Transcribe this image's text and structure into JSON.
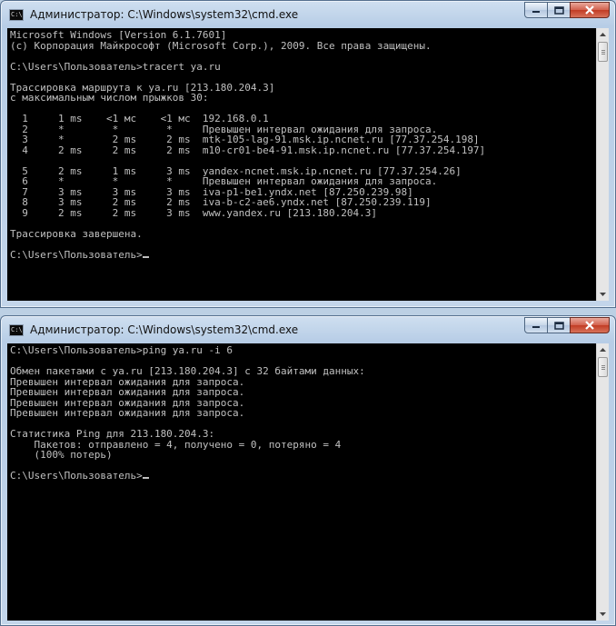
{
  "window1": {
    "title": "Администратор: C:\\Windows\\system32\\cmd.exe",
    "icon_label": "C:\\",
    "lines": [
      "Microsoft Windows [Version 6.1.7601]",
      "(c) Корпорация Майкрософт (Microsoft Corp.), 2009. Все права защищены.",
      "",
      "C:\\Users\\Пользователь>tracert ya.ru",
      "",
      "Трассировка маршрута к ya.ru [213.180.204.3]",
      "с максимальным числом прыжков 30:",
      "",
      "  1     1 ms    <1 мс    <1 мс  192.168.0.1",
      "  2     *        *        *     Превышен интервал ожидания для запроса.",
      "  3     *        2 ms     2 ms  mtk-105-lag-91.msk.ip.ncnet.ru [77.37.254.198]",
      "  4     2 ms     2 ms     2 ms  m10-cr01-be4-91.msk.ip.ncnet.ru [77.37.254.197]",
      "",
      "  5     2 ms     1 ms     3 ms  yandex-ncnet.msk.ip.ncnet.ru [77.37.254.26]",
      "  6     *        *        *     Превышен интервал ожидания для запроса.",
      "  7     3 ms     3 ms     3 ms  iva-p1-be1.yndx.net [87.250.239.98]",
      "  8     3 ms     2 ms     2 ms  iva-b-c2-ae6.yndx.net [87.250.239.119]",
      "  9     2 ms     2 ms     3 ms  www.yandex.ru [213.180.204.3]",
      "",
      "Трассировка завершена.",
      "",
      "C:\\Users\\Пользователь>"
    ]
  },
  "window2": {
    "title": "Администратор: C:\\Windows\\system32\\cmd.exe",
    "icon_label": "C:\\",
    "lines": [
      "C:\\Users\\Пользователь>ping ya.ru -i 6",
      "",
      "Обмен пакетами с ya.ru [213.180.204.3] с 32 байтами данных:",
      "Превышен интервал ожидания для запроса.",
      "Превышен интервал ожидания для запроса.",
      "Превышен интервал ожидания для запроса.",
      "Превышен интервал ожидания для запроса.",
      "",
      "Статистика Ping для 213.180.204.3:",
      "    Пакетов: отправлено = 4, получено = 0, потеряно = 4",
      "    (100% потерь)",
      "",
      "C:\\Users\\Пользователь>"
    ]
  },
  "colors": {
    "console_bg": "#000000",
    "console_text": "#c0c0c0",
    "close_button": "#c7432b",
    "titlebar": "#b9cfe7"
  },
  "icons": [
    "cmd-app-icon",
    "minimize-icon",
    "maximize-icon",
    "close-icon",
    "scroll-up-icon",
    "scroll-down-icon"
  ]
}
